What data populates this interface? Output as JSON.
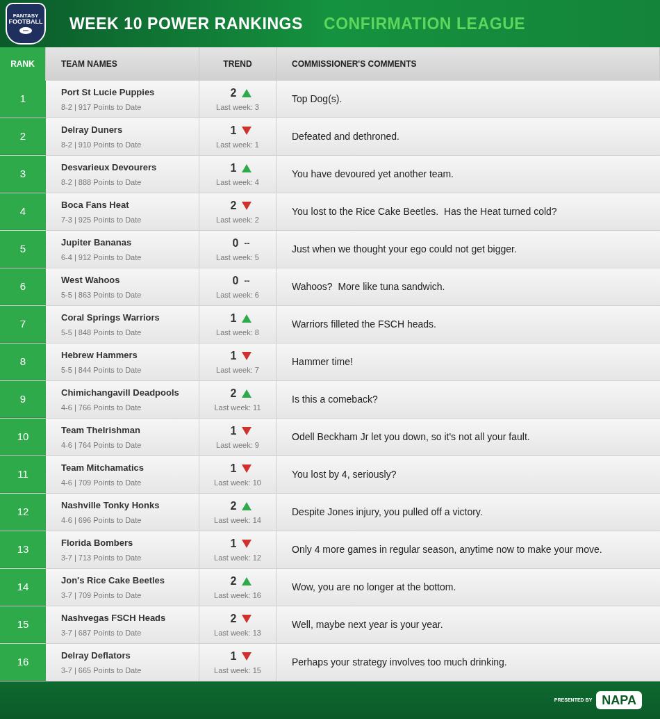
{
  "header": {
    "logo": {
      "top": "FANTASY",
      "bottom": "FOOTBALL"
    },
    "title": "WEEK 10 POWER RANKINGS",
    "league": "CONFIRMATION LEAGUE"
  },
  "table": {
    "columns": [
      "RANK",
      "TEAM NAMES",
      "TREND",
      "COMMISSIONER'S COMMENTS"
    ],
    "rows": [
      {
        "rank": "1",
        "team": "Port St Lucie Puppies",
        "record": "8-2 | 917 Points to Date",
        "change": "2",
        "kind": "up",
        "last_week": "Last week: 3",
        "comment": "Top Dog(s)."
      },
      {
        "rank": "2",
        "team": "Delray Duners",
        "record": "8-2 | 910 Points to Date",
        "change": "1",
        "kind": "down",
        "last_week": "Last week: 1",
        "comment": "Defeated and dethroned."
      },
      {
        "rank": "3",
        "team": "Desvarieux Devourers",
        "record": "8-2 | 888 Points to Date",
        "change": "1",
        "kind": "up",
        "last_week": "Last week: 4",
        "comment": "You have devoured yet another team."
      },
      {
        "rank": "4",
        "team": "Boca Fans Heat",
        "record": "7-3 | 925 Points to Date",
        "change": "2",
        "kind": "down",
        "last_week": "Last week: 2",
        "comment": "You lost to the Rice Cake Beetles.  Has the Heat turned cold?"
      },
      {
        "rank": "5",
        "team": "Jupiter Bananas",
        "record": "6-4 | 912 Points to Date",
        "change": "0",
        "kind": "none",
        "marker": "--",
        "last_week": "Last week: 5",
        "comment": "Just when we thought your ego could not get bigger."
      },
      {
        "rank": "6",
        "team": "West Wahoos",
        "record": "5-5 | 863 Points to Date",
        "change": "0",
        "kind": "none",
        "marker": "--",
        "last_week": "Last week: 6",
        "comment": "Wahoos?  More like tuna sandwich."
      },
      {
        "rank": "7",
        "team": "Coral Springs Warriors",
        "record": "5-5 | 848 Points to Date",
        "change": "1",
        "kind": "up",
        "last_week": "Last week: 8",
        "comment": "Warriors filleted the FSCH heads."
      },
      {
        "rank": "8",
        "team": "Hebrew Hammers",
        "record": "5-5 | 844 Points to Date",
        "change": "1",
        "kind": "down",
        "last_week": "Last week: 7",
        "comment": "Hammer time!"
      },
      {
        "rank": "9",
        "team": "Chimichangavill Deadpools",
        "record": "4-6 | 766 Points to Date",
        "change": "2",
        "kind": "up",
        "last_week": "Last week: 11",
        "comment": "Is this a comeback?"
      },
      {
        "rank": "10",
        "team": "Team TheIrishman",
        "record": "4-6 | 764 Points to Date",
        "change": "1",
        "kind": "down",
        "last_week": "Last week: 9",
        "comment": "Odell Beckham Jr let you down, so it's not all your fault."
      },
      {
        "rank": "11",
        "team": "Team Mitchamatics",
        "record": "4-6 | 709 Points to Date",
        "change": "1",
        "kind": "down",
        "last_week": "Last week: 10",
        "comment": "You lost by 4, seriously?"
      },
      {
        "rank": "12",
        "team": "Nashville Tonky Honks",
        "record": "4-6 | 696 Points to Date",
        "change": "2",
        "kind": "up",
        "last_week": "Last week: 14",
        "comment": "Despite Jones injury, you pulled off a victory."
      },
      {
        "rank": "13",
        "team": "Florida Bombers",
        "record": "3-7 | 713 Points to Date",
        "change": "1",
        "kind": "down",
        "last_week": "Last week: 12",
        "comment": "Only 4 more games in regular season, anytime now to make your move."
      },
      {
        "rank": "14",
        "team": "Jon's Rice Cake Beetles",
        "record": "3-7 | 709 Points to Date",
        "change": "2",
        "kind": "up",
        "last_week": "Last week: 16",
        "comment": "Wow, you are no longer at the bottom."
      },
      {
        "rank": "15",
        "team": "Nashvegas FSCH Heads",
        "record": "3-7 | 687 Points to Date",
        "change": "2",
        "kind": "down",
        "last_week": "Last week: 13",
        "comment": "Well, maybe next year is your year."
      },
      {
        "rank": "16",
        "team": "Delray Deflators",
        "record": "3-7 | 665 Points to Date",
        "change": "1",
        "kind": "down",
        "last_week": "Last week: 15",
        "comment": "Perhaps your strategy involves too much drinking."
      }
    ]
  },
  "footer": {
    "presented_by": "PRESENTED BY",
    "sponsor": "NAPA"
  }
}
